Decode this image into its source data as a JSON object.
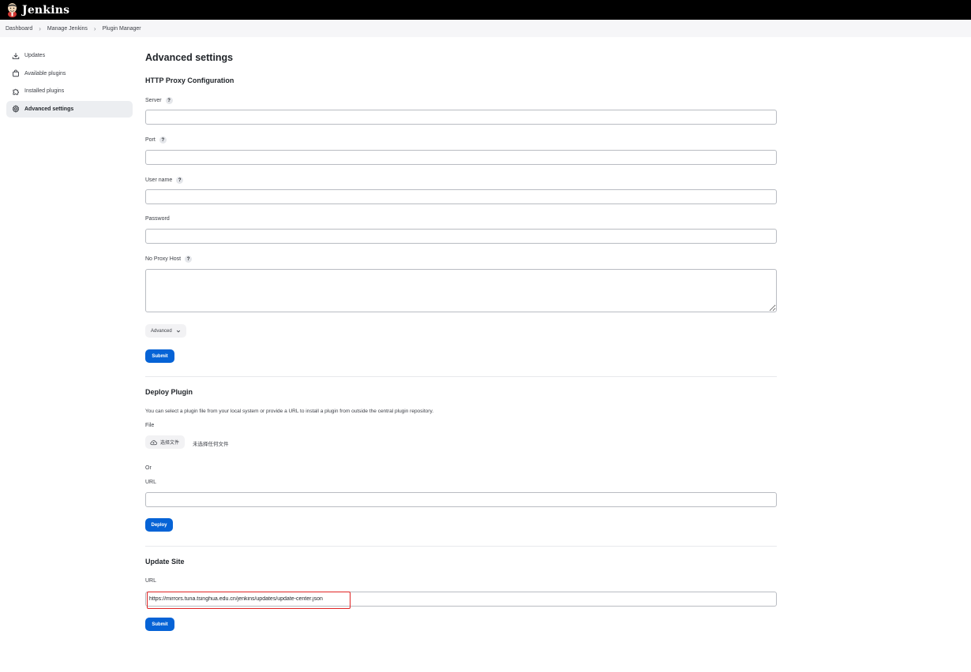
{
  "app": {
    "brand": "Jenkins"
  },
  "breadcrumbs": [
    "Dashboard",
    "Manage Jenkins",
    "Plugin Manager"
  ],
  "sidebar": {
    "items": [
      {
        "label": "Updates",
        "icon": "download-icon"
      },
      {
        "label": "Available plugins",
        "icon": "shopping-bag-icon"
      },
      {
        "label": "Installed plugins",
        "icon": "puzzle-icon"
      },
      {
        "label": "Advanced settings",
        "icon": "gear-icon",
        "active": true
      }
    ]
  },
  "page": {
    "title": "Advanced settings"
  },
  "proxy": {
    "heading": "HTTP Proxy Configuration",
    "server_label": "Server",
    "server_value": "",
    "port_label": "Port",
    "port_value": "",
    "username_label": "User name",
    "username_value": "",
    "password_label": "Password",
    "password_value": "",
    "no_proxy_label": "No Proxy Host",
    "no_proxy_value": "",
    "advanced_label": "Advanced",
    "submit_label": "Submit",
    "help_glyph": "?"
  },
  "deploy": {
    "heading": "Deploy Plugin",
    "description": "You can select a plugin file from your local system or provide a URL to install a plugin from outside the central plugin repository.",
    "file_label": "File",
    "choose_file_label": "选择文件",
    "no_file_text": "未选择任何文件",
    "or_text": "Or",
    "url_label": "URL",
    "url_value": "",
    "deploy_label": "Deploy"
  },
  "update_site": {
    "heading": "Update Site",
    "url_label": "URL",
    "url_value": "https://mirrors.tuna.tsinghua.edu.cn/jenkins/updates/update-center.json",
    "submit_label": "Submit"
  },
  "colors": {
    "primary": "#0663d6",
    "header_bg": "#000000",
    "highlight": "#e02424"
  }
}
